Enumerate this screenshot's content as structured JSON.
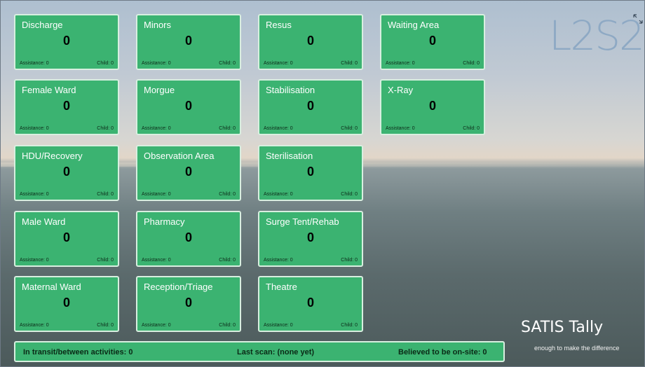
{
  "logo_text": "L2S2",
  "expand_icon": "expand-arrows-icon",
  "tiles": [
    {
      "name": "Discharge",
      "count": "0",
      "assistance": "Assistance: 0",
      "child": "Child: 0"
    },
    {
      "name": "Minors",
      "count": "0",
      "assistance": "Assistance: 0",
      "child": "Child: 0"
    },
    {
      "name": "Resus",
      "count": "0",
      "assistance": "Assistance: 0",
      "child": "Child: 0"
    },
    {
      "name": "Waiting Area",
      "count": "0",
      "assistance": "Assistance: 0",
      "child": "Child: 0"
    },
    {
      "name": "Female Ward",
      "count": "0",
      "assistance": "Assistance: 0",
      "child": "Child: 0"
    },
    {
      "name": "Morgue",
      "count": "0",
      "assistance": "Assistance: 0",
      "child": "Child: 0"
    },
    {
      "name": "Stabilisation",
      "count": "0",
      "assistance": "Assistance: 0",
      "child": "Child: 0"
    },
    {
      "name": "X-Ray",
      "count": "0",
      "assistance": "Assistance: 0",
      "child": "Child: 0"
    },
    {
      "name": "HDU/Recovery",
      "count": "0",
      "assistance": "Assistance: 0",
      "child": "Child: 0"
    },
    {
      "name": "Observation Area",
      "count": "0",
      "assistance": "Assistance: 0",
      "child": "Child: 0"
    },
    {
      "name": "Sterilisation",
      "count": "0",
      "assistance": "Assistance: 0",
      "child": "Child: 0"
    },
    {
      "name": "Male Ward",
      "count": "0",
      "assistance": "Assistance: 0",
      "child": "Child: 0"
    },
    {
      "name": "Pharmacy",
      "count": "0",
      "assistance": "Assistance: 0",
      "child": "Child: 0"
    },
    {
      "name": "Surge Tent/Rehab",
      "count": "0",
      "assistance": "Assistance: 0",
      "child": "Child: 0"
    },
    {
      "name": "Maternal Ward",
      "count": "0",
      "assistance": "Assistance: 0",
      "child": "Child: 0"
    },
    {
      "name": "Reception/Triage",
      "count": "0",
      "assistance": "Assistance: 0",
      "child": "Child: 0"
    },
    {
      "name": "Theatre",
      "count": "0",
      "assistance": "Assistance: 0",
      "child": "Child: 0"
    }
  ],
  "status": {
    "in_transit": "In transit/between activities: 0",
    "last_scan": "Last scan: (none yet)",
    "on_site": "Believed to be on-site: 0"
  },
  "brand": {
    "title": "SATIS Tally",
    "tagline": "enough to make the difference"
  },
  "colors": {
    "tile_green": "#3bb371",
    "logo_blue": "#8ea9c4"
  }
}
